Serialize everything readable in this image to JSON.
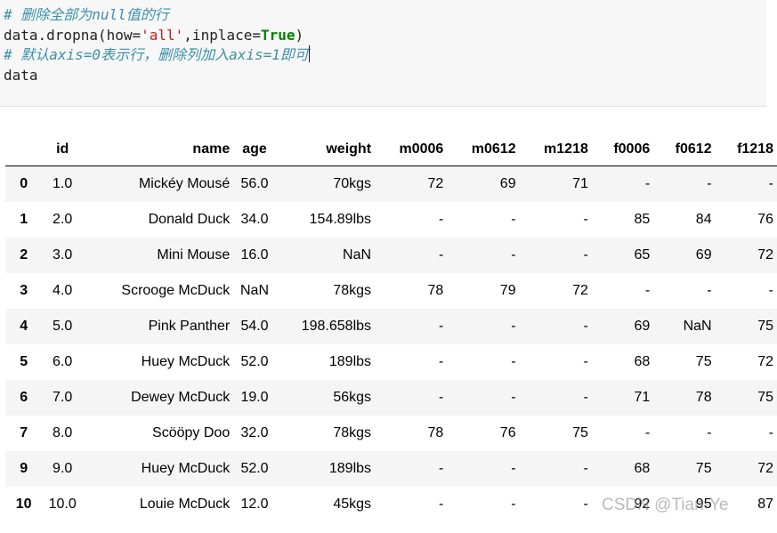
{
  "code": {
    "line1_comment": "# 删除全部为null值的行",
    "line2_prefix": "data.dropna(how=",
    "line2_str": "'all'",
    "line2_mid": ",inplace=",
    "line2_kw": "True",
    "line2_suffix": ")",
    "line3_comment": "# 默认axis=0表示行，删除列加入axis=1即可",
    "line4": "data"
  },
  "table": {
    "columns": [
      "",
      "id",
      "name",
      "age",
      "weight",
      "m0006",
      "m0612",
      "m1218",
      "f0006",
      "f0612",
      "f1218"
    ],
    "rows": [
      [
        "0",
        "1.0",
        "Mickéy Mousé",
        "56.0",
        "70kgs",
        "72",
        "69",
        "71",
        "-",
        "-",
        "-"
      ],
      [
        "1",
        "2.0",
        "Donald Duck",
        "34.0",
        "154.89lbs",
        "-",
        "-",
        "-",
        "85",
        "84",
        "76"
      ],
      [
        "2",
        "3.0",
        "Mini Mouse",
        "16.0",
        "NaN",
        "-",
        "-",
        "-",
        "65",
        "69",
        "72"
      ],
      [
        "3",
        "4.0",
        "Scrooge McDuck",
        "NaN",
        "78kgs",
        "78",
        "79",
        "72",
        "-",
        "-",
        "-"
      ],
      [
        "4",
        "5.0",
        "Pink Panther",
        "54.0",
        "198.658lbs",
        "-",
        "-",
        "-",
        "69",
        "NaN",
        "75"
      ],
      [
        "5",
        "6.0",
        "Huey McDuck",
        "52.0",
        "189lbs",
        "-",
        "-",
        "-",
        "68",
        "75",
        "72"
      ],
      [
        "6",
        "7.0",
        "Dewey McDuck",
        "19.0",
        "56kgs",
        "-",
        "-",
        "-",
        "71",
        "78",
        "75"
      ],
      [
        "7",
        "8.0",
        "Scööpy Doo",
        "32.0",
        "78kgs",
        "78",
        "76",
        "75",
        "-",
        "-",
        "-"
      ],
      [
        "9",
        "9.0",
        "Huey McDuck",
        "52.0",
        "189lbs",
        "-",
        "-",
        "-",
        "68",
        "75",
        "72"
      ],
      [
        "10",
        "10.0",
        "Louie McDuck",
        "12.0",
        "45kgs",
        "-",
        "-",
        "-",
        "92",
        "95",
        "87"
      ]
    ]
  },
  "watermark": "CSDN @Tian-Ye"
}
